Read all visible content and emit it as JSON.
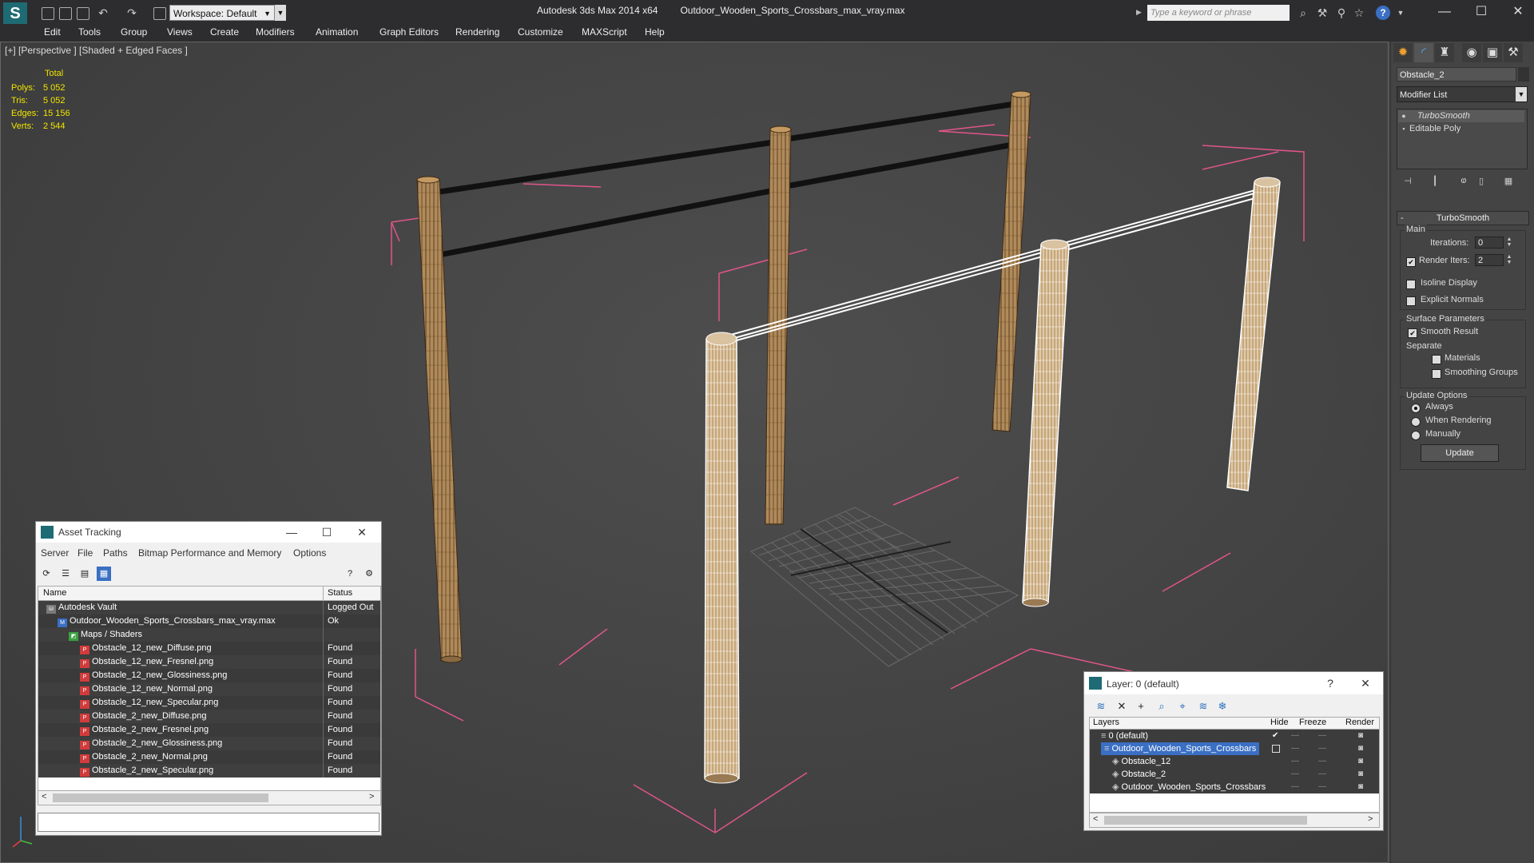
{
  "window": {
    "app_name": "Autodesk 3ds Max  2014 x64",
    "file_name": "Outdoor_Wooden_Sports_Crossbars_max_vray.max",
    "workspace_label": "Workspace: Default",
    "search_placeholder": "Type a keyword or phrase",
    "minimize": "—",
    "maximize": "☐",
    "close": "✕"
  },
  "menu": [
    "Edit",
    "Tools",
    "Group",
    "Views",
    "Create",
    "Modifiers",
    "Animation",
    "Graph Editors",
    "Rendering",
    "Customize",
    "MAXScript",
    "Help"
  ],
  "viewport": {
    "label": "[+] [Perspective ] [Shaded + Edged Faces ]",
    "stats": {
      "total_label": "Total",
      "rows": [
        {
          "label": "Polys:",
          "value": "5 052"
        },
        {
          "label": "Tris:",
          "value": "5 052"
        },
        {
          "label": "Edges:",
          "value": "15 156"
        },
        {
          "label": "Verts:",
          "value": "2 544"
        }
      ]
    }
  },
  "command_panel": {
    "object_name": "Obstacle_2",
    "modifier_list": "Modifier List",
    "stack": [
      "TurboSmooth",
      "Editable Poly"
    ],
    "rollout_title": "TurboSmooth",
    "main": {
      "title": "Main",
      "iterations_label": "Iterations:",
      "iterations_value": "0",
      "render_iters_label": "Render Iters:",
      "render_iters_value": "2",
      "isoline": "Isoline Display",
      "explicit": "Explicit Normals"
    },
    "surface": {
      "title": "Surface Parameters",
      "smooth_result": "Smooth Result",
      "separate": "Separate",
      "materials": "Materials",
      "smoothing_groups": "Smoothing Groups"
    },
    "update": {
      "title": "Update Options",
      "always": "Always",
      "when_rendering": "When Rendering",
      "manually": "Manually",
      "button": "Update"
    }
  },
  "asset_tracking": {
    "title": "Asset Tracking",
    "menu": [
      "Server",
      "File",
      "Paths",
      "Bitmap Performance and Memory",
      "Options"
    ],
    "columns": {
      "name": "Name",
      "status": "Status"
    },
    "rows": [
      {
        "name": "Autodesk Vault",
        "status": "Logged Out",
        "indent": 0,
        "icon": "vault"
      },
      {
        "name": "Outdoor_Wooden_Sports_Crossbars_max_vray.max",
        "status": "Ok",
        "indent": 1,
        "icon": "max"
      },
      {
        "name": "Maps / Shaders",
        "status": "",
        "indent": 2,
        "icon": "maps"
      },
      {
        "name": "Obstacle_12_new_Diffuse.png",
        "status": "Found",
        "indent": 3,
        "icon": "png"
      },
      {
        "name": "Obstacle_12_new_Fresnel.png",
        "status": "Found",
        "indent": 3,
        "icon": "png"
      },
      {
        "name": "Obstacle_12_new_Glossiness.png",
        "status": "Found",
        "indent": 3,
        "icon": "png"
      },
      {
        "name": "Obstacle_12_new_Normal.png",
        "status": "Found",
        "indent": 3,
        "icon": "png"
      },
      {
        "name": "Obstacle_12_new_Specular.png",
        "status": "Found",
        "indent": 3,
        "icon": "png"
      },
      {
        "name": "Obstacle_2_new_Diffuse.png",
        "status": "Found",
        "indent": 3,
        "icon": "png"
      },
      {
        "name": "Obstacle_2_new_Fresnel.png",
        "status": "Found",
        "indent": 3,
        "icon": "png"
      },
      {
        "name": "Obstacle_2_new_Glossiness.png",
        "status": "Found",
        "indent": 3,
        "icon": "png"
      },
      {
        "name": "Obstacle_2_new_Normal.png",
        "status": "Found",
        "indent": 3,
        "icon": "png"
      },
      {
        "name": "Obstacle_2_new_Specular.png",
        "status": "Found",
        "indent": 3,
        "icon": "png"
      }
    ]
  },
  "layer_window": {
    "title": "Layer: 0 (default)",
    "help": "?",
    "columns": {
      "layers": "Layers",
      "hide": "Hide",
      "freeze": "Freeze",
      "render": "Render"
    },
    "rows": [
      {
        "name": "0 (default)",
        "indent": 0,
        "selected": false
      },
      {
        "name": "Outdoor_Wooden_Sports_Crossbars",
        "indent": 0,
        "selected": true
      },
      {
        "name": "Obstacle_12",
        "indent": 1,
        "selected": false
      },
      {
        "name": "Obstacle_2",
        "indent": 1,
        "selected": false
      },
      {
        "name": "Outdoor_Wooden_Sports_Crossbars",
        "indent": 1,
        "selected": false
      }
    ]
  },
  "colors": {
    "stats_yellow": "#f1e500",
    "bbox_pink": "#e0558a",
    "selection_blue": "#3a6fc4",
    "wood": "#b08a5a"
  }
}
